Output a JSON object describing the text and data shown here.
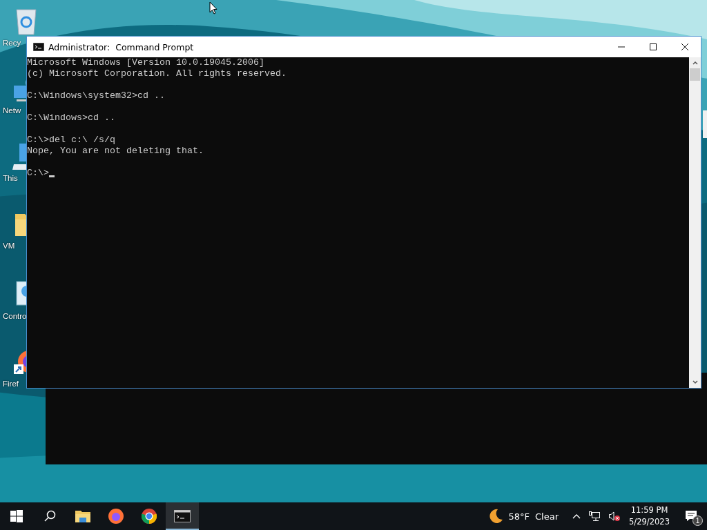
{
  "desktop_icons": [
    {
      "kind": "recycle",
      "label": "Recy"
    },
    {
      "kind": "network",
      "label": "Netw"
    },
    {
      "kind": "computer",
      "label": "This"
    },
    {
      "kind": "folder",
      "label": "VM"
    },
    {
      "kind": "control",
      "label": "Contro"
    },
    {
      "kind": "firefox",
      "label": "Firef"
    }
  ],
  "window": {
    "title": "Administrator:  Command Prompt",
    "blocks": [
      [
        "Microsoft Windows [Version 10.0.19045.2006]",
        "(c) Microsoft Corporation. All rights reserved."
      ],
      [
        "C:\\Windows\\system32>cd .."
      ],
      [
        "C:\\Windows>cd .."
      ],
      [
        "C:\\>del c:\\ /s/q",
        "Nope, You are not deleting that."
      ],
      [
        "C:\\>"
      ]
    ],
    "cursor": true
  },
  "taskbar": {
    "apps": [
      {
        "kind": "explorer",
        "selected": false
      },
      {
        "kind": "firefox",
        "selected": false
      },
      {
        "kind": "chrome",
        "selected": false
      },
      {
        "kind": "terminal",
        "selected": true
      }
    ],
    "weather": {
      "temperature": "58°F",
      "condition": "Clear"
    },
    "time": "11:59 PM",
    "date": "5/29/2023",
    "notification_count": "1"
  }
}
